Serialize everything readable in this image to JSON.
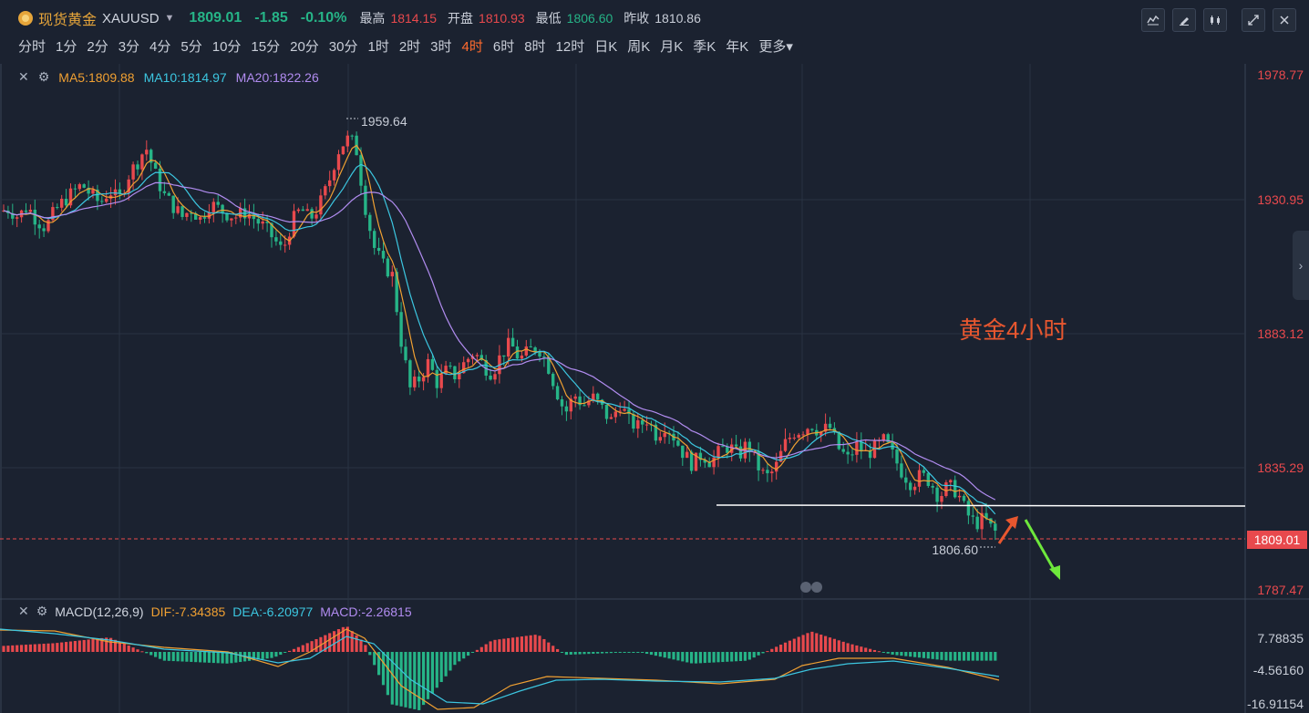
{
  "symbol": {
    "name": "现货黄金",
    "code": "XAUUSD",
    "price": "1809.01",
    "change": "-1.85",
    "change_pct": "-0.10%",
    "high_label": "最高",
    "high": "1814.15",
    "open_label": "开盘",
    "open": "1810.93",
    "low_label": "最低",
    "low": "1806.60",
    "prev_close_label": "昨收",
    "prev_close": "1810.86"
  },
  "periods": [
    "分时",
    "1分",
    "2分",
    "3分",
    "4分",
    "5分",
    "10分",
    "15分",
    "20分",
    "30分",
    "1时",
    "2时",
    "3时",
    "4时",
    "6时",
    "8时",
    "12时",
    "日K",
    "周K",
    "月K",
    "季K",
    "年K",
    "更多"
  ],
  "active_period": "4时",
  "toolbar_icons": [
    "indicator-icon",
    "draw-icon",
    "candle-type-icon",
    "fullscreen-icon",
    "close-icon"
  ],
  "ma_legend": {
    "ma5": "MA5:1809.88",
    "ma10": "MA10:1814.97",
    "ma20": "MA20:1822.26"
  },
  "price_axis": [
    "1978.77",
    "1930.95",
    "1883.12",
    "1835.29",
    "1787.47"
  ],
  "current_price_tag": "1809.01",
  "high_marker": "1959.64",
  "low_marker": "1806.60",
  "annotation_text": "黄金4小时",
  "macd_legend": {
    "title": "MACD(12,26,9)",
    "dif": "DIF:-7.34385",
    "dea": "DEA:-6.20977",
    "macd": "MACD:-2.26815"
  },
  "macd_axis": [
    "7.78835",
    "-4.56160",
    "-16.91154"
  ],
  "colors": {
    "background": "#1b2230",
    "up": "#e8494d",
    "down": "#26b487",
    "ma5": "#f0a032",
    "ma10": "#3cc6e0",
    "ma20": "#b18cf0",
    "accent": "#ff6b2e"
  }
}
